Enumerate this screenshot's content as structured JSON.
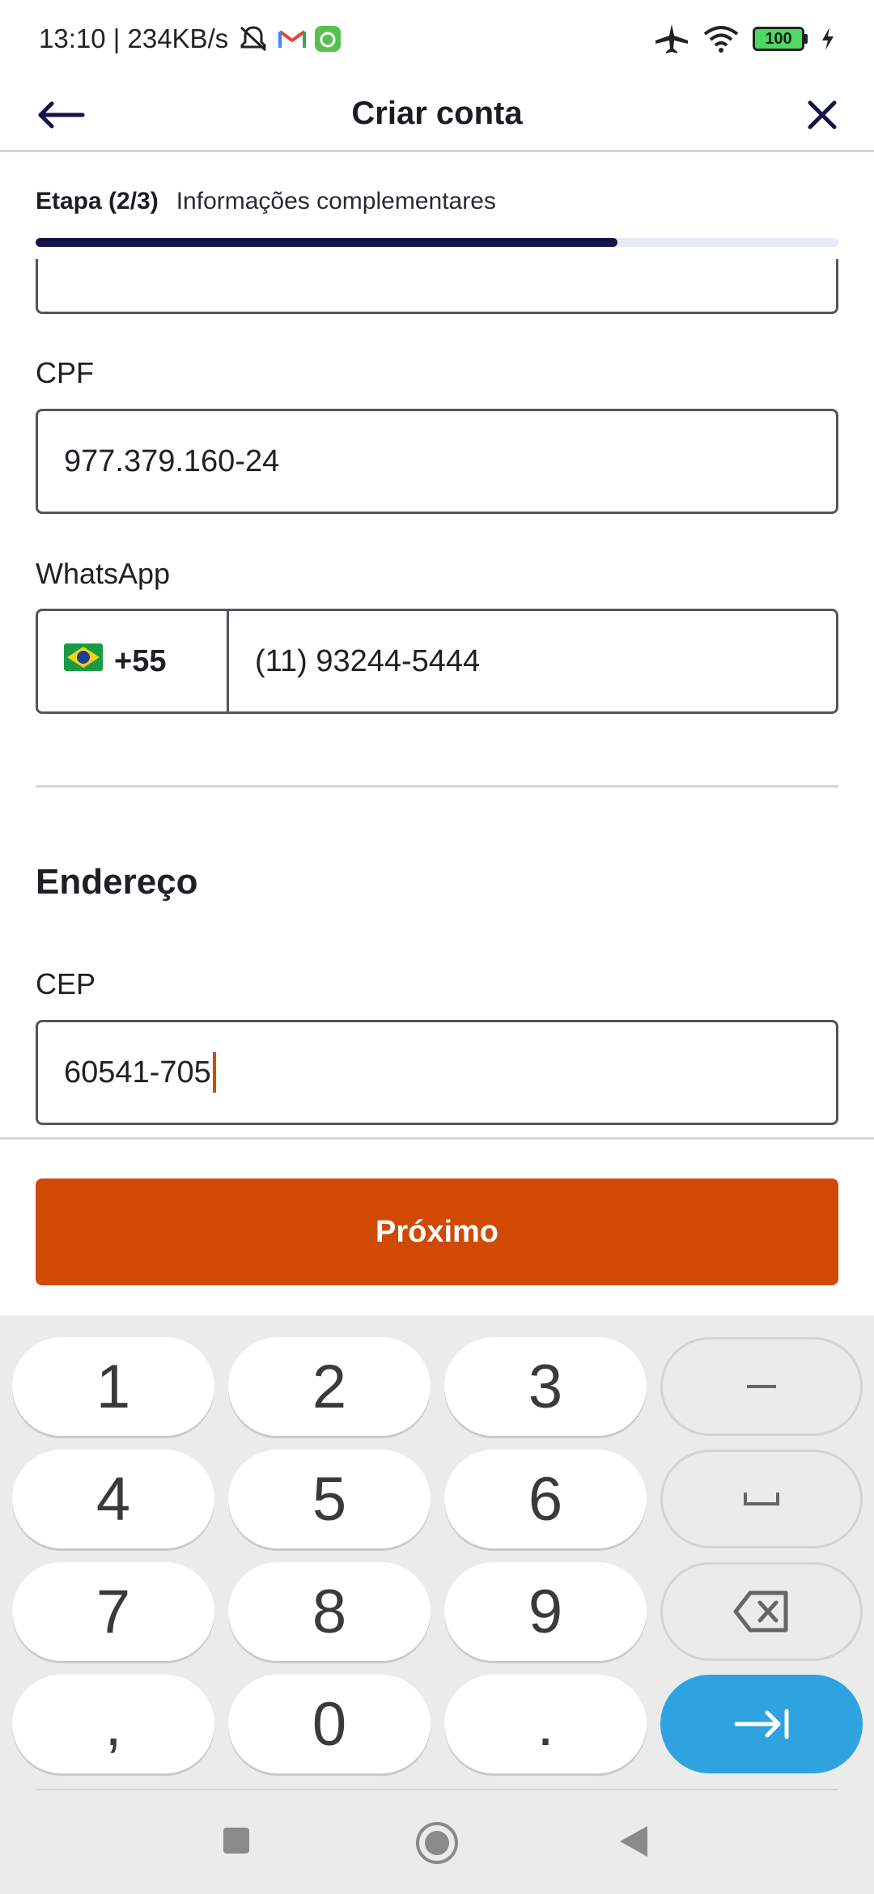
{
  "status_bar": {
    "time_speed": "13:10 | 234KB/s",
    "battery_level": "100",
    "icons": [
      "mute-icon",
      "gmail-icon",
      "app-notification-icon",
      "airplane-mode-icon",
      "wifi-icon",
      "battery-icon",
      "charging-icon"
    ]
  },
  "app_bar": {
    "title": "Criar conta",
    "back_icon": "arrow-left-icon",
    "close_icon": "close-icon"
  },
  "step": {
    "label": "Etapa (2/3)",
    "description": "Informações complementares",
    "progress": 0.725,
    "progress_color": "#15134a",
    "track_color": "#e8e9f7"
  },
  "form": {
    "cpf_label": "CPF",
    "cpf_value": "977.379.160-24",
    "whatsapp_label": "WhatsApp",
    "country_flag": "🇧🇷",
    "country_code": "+55",
    "phone_value": "(11) 93244-5444",
    "address_section_title": "Endereço",
    "cep_label": "CEP",
    "cep_value": "60541-705"
  },
  "actions": {
    "next_label": "Próximo",
    "next_color": "#d04a02"
  },
  "keyboard": {
    "keys": [
      "1",
      "2",
      "3",
      "–",
      "4",
      "5",
      "6",
      "␣",
      "7",
      "8",
      "9",
      "⌫",
      ",",
      "0",
      ".",
      "→|"
    ],
    "enter_color": "#2ea3e0"
  },
  "nav": {
    "icons": [
      "recent-apps-icon",
      "home-icon",
      "back-icon"
    ]
  }
}
